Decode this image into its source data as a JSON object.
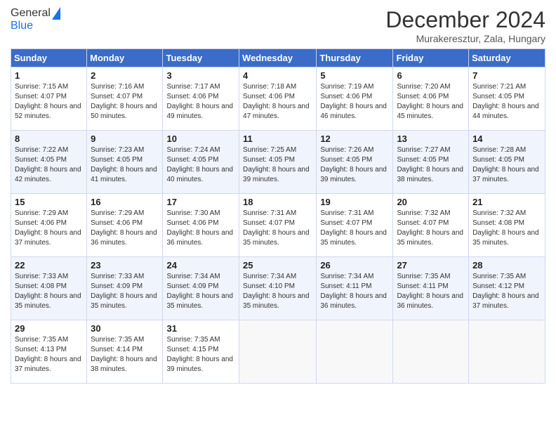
{
  "header": {
    "logo_general": "General",
    "logo_blue": "Blue",
    "month_title": "December 2024",
    "subtitle": "Murakeresztur, Zala, Hungary"
  },
  "weekdays": [
    "Sunday",
    "Monday",
    "Tuesday",
    "Wednesday",
    "Thursday",
    "Friday",
    "Saturday"
  ],
  "weeks": [
    [
      {
        "day": "1",
        "sunrise": "7:15 AM",
        "sunset": "4:07 PM",
        "daylight": "8 hours and 52 minutes."
      },
      {
        "day": "2",
        "sunrise": "7:16 AM",
        "sunset": "4:07 PM",
        "daylight": "8 hours and 50 minutes."
      },
      {
        "day": "3",
        "sunrise": "7:17 AM",
        "sunset": "4:06 PM",
        "daylight": "8 hours and 49 minutes."
      },
      {
        "day": "4",
        "sunrise": "7:18 AM",
        "sunset": "4:06 PM",
        "daylight": "8 hours and 47 minutes."
      },
      {
        "day": "5",
        "sunrise": "7:19 AM",
        "sunset": "4:06 PM",
        "daylight": "8 hours and 46 minutes."
      },
      {
        "day": "6",
        "sunrise": "7:20 AM",
        "sunset": "4:06 PM",
        "daylight": "8 hours and 45 minutes."
      },
      {
        "day": "7",
        "sunrise": "7:21 AM",
        "sunset": "4:05 PM",
        "daylight": "8 hours and 44 minutes."
      }
    ],
    [
      {
        "day": "8",
        "sunrise": "7:22 AM",
        "sunset": "4:05 PM",
        "daylight": "8 hours and 42 minutes."
      },
      {
        "day": "9",
        "sunrise": "7:23 AM",
        "sunset": "4:05 PM",
        "daylight": "8 hours and 41 minutes."
      },
      {
        "day": "10",
        "sunrise": "7:24 AM",
        "sunset": "4:05 PM",
        "daylight": "8 hours and 40 minutes."
      },
      {
        "day": "11",
        "sunrise": "7:25 AM",
        "sunset": "4:05 PM",
        "daylight": "8 hours and 39 minutes."
      },
      {
        "day": "12",
        "sunrise": "7:26 AM",
        "sunset": "4:05 PM",
        "daylight": "8 hours and 39 minutes."
      },
      {
        "day": "13",
        "sunrise": "7:27 AM",
        "sunset": "4:05 PM",
        "daylight": "8 hours and 38 minutes."
      },
      {
        "day": "14",
        "sunrise": "7:28 AM",
        "sunset": "4:05 PM",
        "daylight": "8 hours and 37 minutes."
      }
    ],
    [
      {
        "day": "15",
        "sunrise": "7:29 AM",
        "sunset": "4:06 PM",
        "daylight": "8 hours and 37 minutes."
      },
      {
        "day": "16",
        "sunrise": "7:29 AM",
        "sunset": "4:06 PM",
        "daylight": "8 hours and 36 minutes."
      },
      {
        "day": "17",
        "sunrise": "7:30 AM",
        "sunset": "4:06 PM",
        "daylight": "8 hours and 36 minutes."
      },
      {
        "day": "18",
        "sunrise": "7:31 AM",
        "sunset": "4:07 PM",
        "daylight": "8 hours and 35 minutes."
      },
      {
        "day": "19",
        "sunrise": "7:31 AM",
        "sunset": "4:07 PM",
        "daylight": "8 hours and 35 minutes."
      },
      {
        "day": "20",
        "sunrise": "7:32 AM",
        "sunset": "4:07 PM",
        "daylight": "8 hours and 35 minutes."
      },
      {
        "day": "21",
        "sunrise": "7:32 AM",
        "sunset": "4:08 PM",
        "daylight": "8 hours and 35 minutes."
      }
    ],
    [
      {
        "day": "22",
        "sunrise": "7:33 AM",
        "sunset": "4:08 PM",
        "daylight": "8 hours and 35 minutes."
      },
      {
        "day": "23",
        "sunrise": "7:33 AM",
        "sunset": "4:09 PM",
        "daylight": "8 hours and 35 minutes."
      },
      {
        "day": "24",
        "sunrise": "7:34 AM",
        "sunset": "4:09 PM",
        "daylight": "8 hours and 35 minutes."
      },
      {
        "day": "25",
        "sunrise": "7:34 AM",
        "sunset": "4:10 PM",
        "daylight": "8 hours and 35 minutes."
      },
      {
        "day": "26",
        "sunrise": "7:34 AM",
        "sunset": "4:11 PM",
        "daylight": "8 hours and 36 minutes."
      },
      {
        "day": "27",
        "sunrise": "7:35 AM",
        "sunset": "4:11 PM",
        "daylight": "8 hours and 36 minutes."
      },
      {
        "day": "28",
        "sunrise": "7:35 AM",
        "sunset": "4:12 PM",
        "daylight": "8 hours and 37 minutes."
      }
    ],
    [
      {
        "day": "29",
        "sunrise": "7:35 AM",
        "sunset": "4:13 PM",
        "daylight": "8 hours and 37 minutes."
      },
      {
        "day": "30",
        "sunrise": "7:35 AM",
        "sunset": "4:14 PM",
        "daylight": "8 hours and 38 minutes."
      },
      {
        "day": "31",
        "sunrise": "7:35 AM",
        "sunset": "4:15 PM",
        "daylight": "8 hours and 39 minutes."
      },
      null,
      null,
      null,
      null
    ]
  ],
  "labels": {
    "sunrise": "Sunrise:",
    "sunset": "Sunset:",
    "daylight": "Daylight:"
  }
}
